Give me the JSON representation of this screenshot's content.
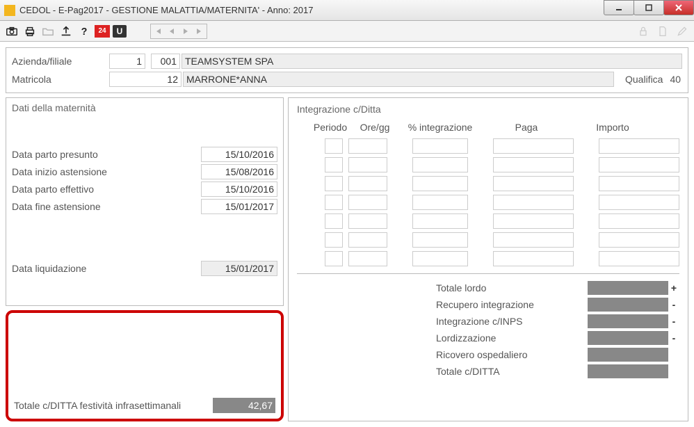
{
  "window": {
    "title": "CEDOL  -  E-Pag2017  -   GESTIONE MALATTIA/MATERNITA' - Anno: 2017"
  },
  "toolbar": {
    "badge24": "24",
    "u": "U"
  },
  "header": {
    "azienda_label": "Azienda/filiale",
    "azienda_num": "1",
    "azienda_code": "001",
    "azienda_name": "TEAMSYSTEM SPA",
    "matricola_label": "Matricola",
    "matricola_num": "12",
    "matricola_name": "MARRONE*ANNA",
    "qualifica_label": "Qualifica",
    "qualifica_val": "40"
  },
  "maternita": {
    "title": "Dati della maternità",
    "parto_presunto_label": "Data parto presunto",
    "parto_presunto": "15/10/2016",
    "inizio_astensione_label": "Data inizio astensione",
    "inizio_astensione": "15/08/2016",
    "parto_effettivo_label": "Data parto effettivo",
    "parto_effettivo": "15/10/2016",
    "fine_astensione_label": "Data fine astensione",
    "fine_astensione": "15/01/2017",
    "liquidazione_label": "Data liquidazione",
    "liquidazione": "15/01/2017"
  },
  "festivita": {
    "label": "Totale c/DITTA festività infrasettimanali",
    "value": "42,67",
    "callout": "1"
  },
  "integ": {
    "title": "Integrazione c/Ditta",
    "h_periodo": "Periodo",
    "h_ore": "Ore/gg",
    "h_int": "% integrazione",
    "h_paga": "Paga",
    "h_importo": "Importo"
  },
  "totals": {
    "lordo_label": "Totale lordo",
    "recupero_label": "Recupero integrazione",
    "cinps_label": "Integrazione c/INPS",
    "lordizz_label": "Lordizzazione",
    "ricovero_label": "Ricovero ospedaliero",
    "cditta_label": "Totale c/DITTA",
    "plus": "+",
    "minus": "-"
  }
}
